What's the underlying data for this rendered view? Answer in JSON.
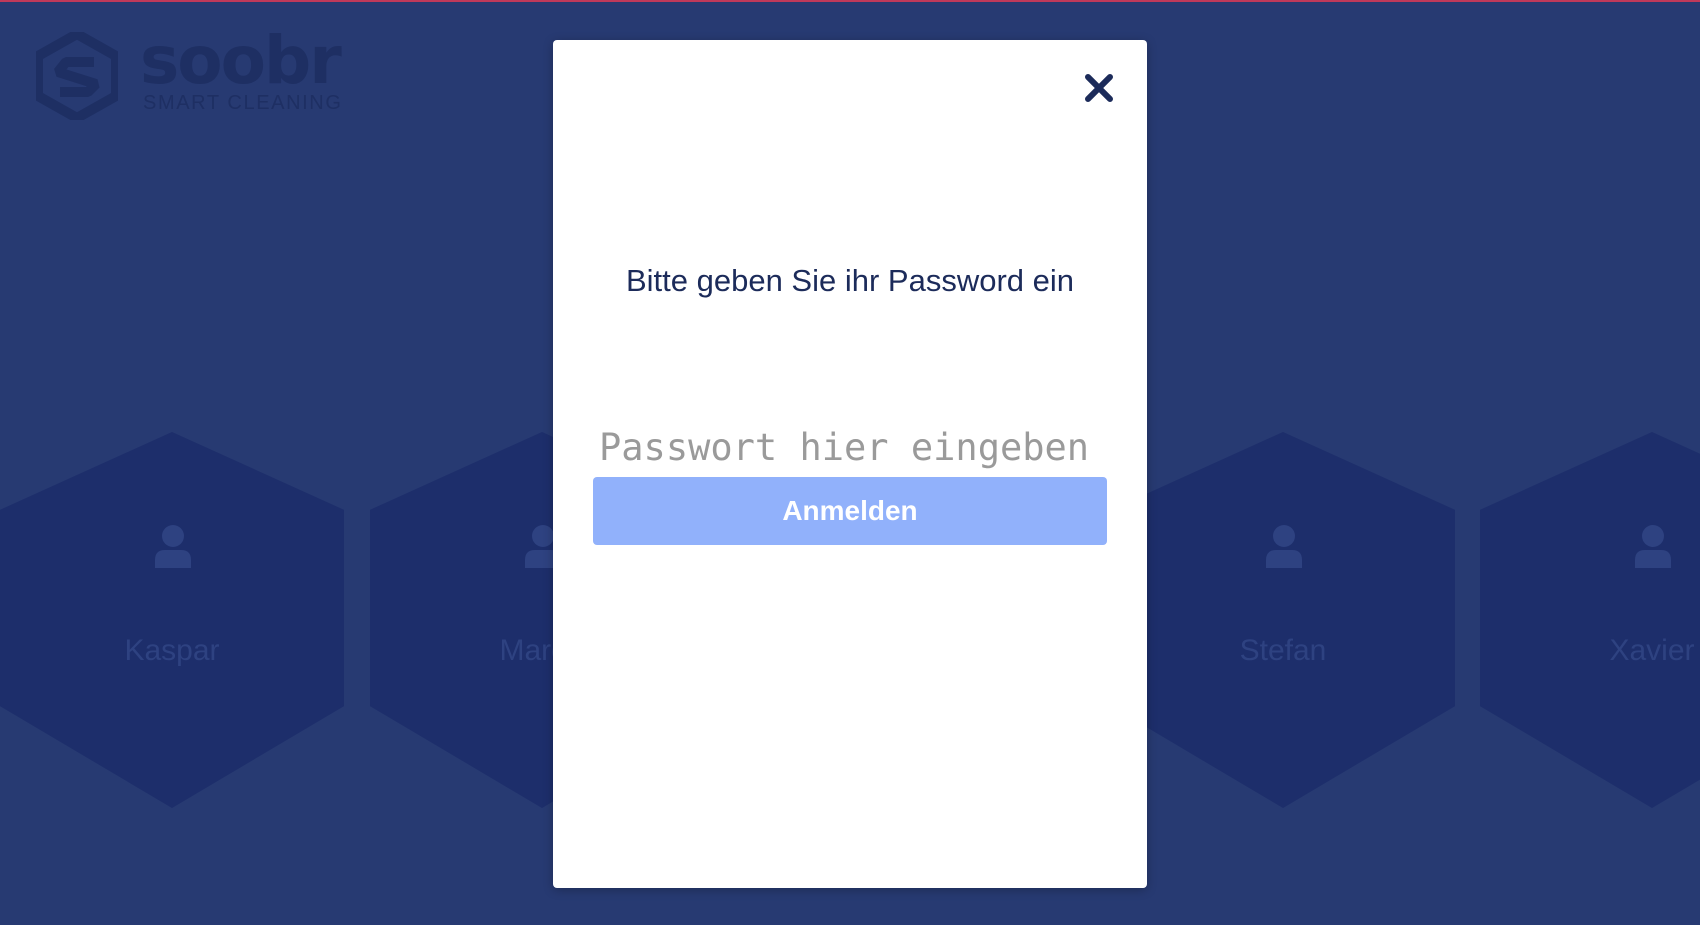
{
  "app": {
    "brand_name": "soobr",
    "brand_tagline": "SMART CLEANING",
    "logo_icon": "soobr-logo-icon"
  },
  "users": [
    {
      "name": "Kaspar",
      "icon": "person-icon"
    },
    {
      "name": "Marga",
      "icon": "person-icon"
    },
    {
      "name": "Stefan",
      "icon": "person-icon"
    },
    {
      "name": "Xavier",
      "icon": "person-icon"
    }
  ],
  "modal": {
    "close_icon": "close-icon",
    "prompt": "Bitte geben Sie ihr Password ein",
    "password_placeholder": "Passwort hier eingeben ...",
    "password_value": "",
    "submit_label": "Anmelden"
  },
  "colors": {
    "page_background": "#273a72",
    "tile_background": "#1d2e6b",
    "primary_text": "#1c2b5a",
    "button_background": "#91b1fb",
    "top_accent": "#c0395a"
  }
}
